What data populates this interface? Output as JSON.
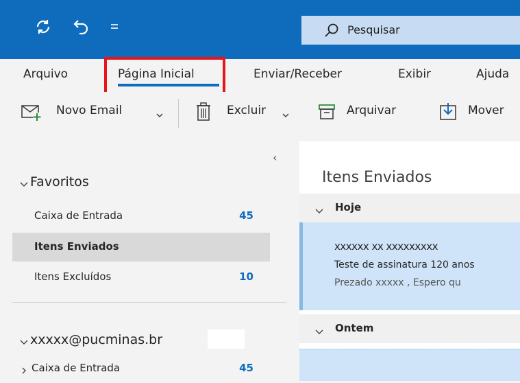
{
  "titlebar": {
    "sync_icon": "sync-icon",
    "undo_icon": "undo-icon",
    "customize_icon": "customize-quick-access-icon",
    "search": {
      "icon": "search-icon",
      "placeholder": "Pesquisar"
    },
    "accent_color": "#0f6cbd"
  },
  "tabs": [
    {
      "label": "Arquivo"
    },
    {
      "label": "Página Inicial",
      "active": true,
      "highlighted": true
    },
    {
      "label": "Enviar/Receber"
    },
    {
      "label": "Exibir"
    },
    {
      "label": "Ajuda"
    }
  ],
  "toolbar": {
    "new_email": "Novo Email",
    "delete": "Excluir",
    "archive": "Arquivar",
    "move": "Mover"
  },
  "folders": {
    "favorites_label": "Favoritos",
    "favorites": [
      {
        "name": "Caixa de Entrada",
        "count": "45"
      },
      {
        "name": "Itens Enviados",
        "count": "",
        "active": true
      },
      {
        "name": "Itens Excluídos",
        "count": "10"
      }
    ],
    "account_label": "xxxxx@pucminas.br",
    "account_folders": [
      {
        "name": "Caixa de Entrada",
        "count": "45"
      }
    ]
  },
  "message_list": {
    "title": "Itens Enviados",
    "groups": [
      {
        "label": "Hoje"
      },
      {
        "label": "Ontem"
      }
    ],
    "messages": [
      {
        "from": "xxxxxx xx xxxxxxxxx",
        "subject": "Teste de assinatura 120 anos",
        "preview": "Prezado xxxxx , Espero qu"
      }
    ]
  }
}
